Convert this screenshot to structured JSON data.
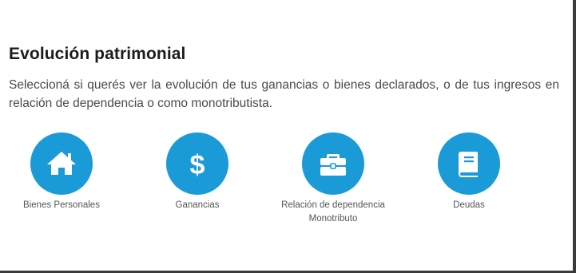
{
  "section": {
    "title": "Evolución patrimonial",
    "description": "Seleccioná si querés ver la evolución de tus ganancias o bienes declarados, o de tus ingresos en relación de dependencia o como monotributista."
  },
  "theme": {
    "accent": "#1a9ad6",
    "icon_fg": "#ffffff"
  },
  "options": [
    {
      "icon": "home-icon",
      "label": "Bienes Personales"
    },
    {
      "icon": "dollar-icon",
      "label": "Ganancias"
    },
    {
      "icon": "briefcase-icon",
      "label": "Relación de dependencia\nMonotributo"
    },
    {
      "icon": "book-icon",
      "label": "Deudas"
    }
  ]
}
